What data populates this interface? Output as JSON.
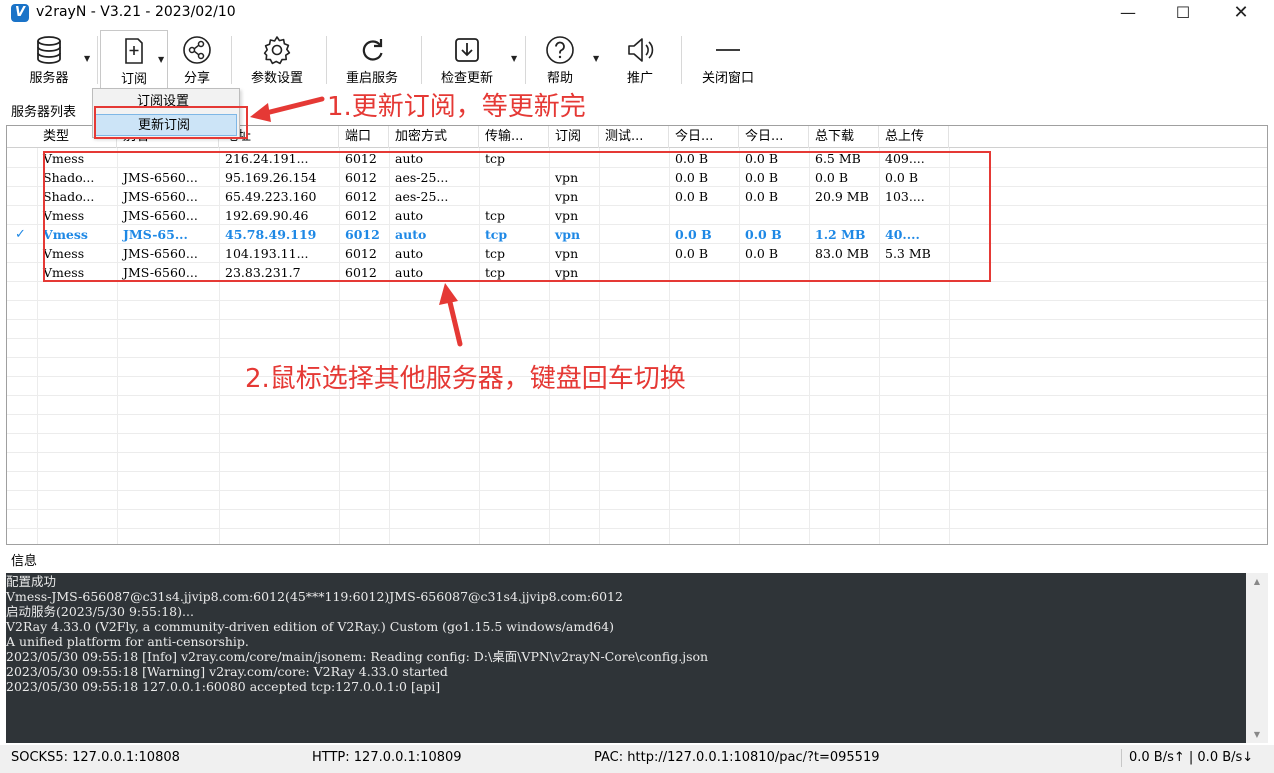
{
  "window": {
    "title": "v2rayN - V3.21 - 2023/02/10",
    "icon_letter": "V",
    "minimize": "—",
    "maximize": "☐",
    "close": "✕"
  },
  "toolbar": [
    {
      "key": "servers",
      "label": "服务器",
      "icon": "database-icon",
      "dropdown": true
    },
    {
      "key": "subscribe",
      "label": "订阅",
      "icon": "subscribe-icon",
      "dropdown": true
    },
    {
      "key": "share",
      "label": "分享",
      "icon": "share-icon",
      "dropdown": false
    },
    {
      "key": "settings",
      "label": "参数设置",
      "icon": "gear-icon",
      "dropdown": false
    },
    {
      "key": "restart",
      "label": "重启服务",
      "icon": "refresh-icon",
      "dropdown": false
    },
    {
      "key": "update",
      "label": "检查更新",
      "icon": "download-icon",
      "dropdown": true
    },
    {
      "key": "help",
      "label": "帮助",
      "icon": "help-icon",
      "dropdown": true
    },
    {
      "key": "promote",
      "label": "推广",
      "icon": "speaker-icon",
      "dropdown": false
    },
    {
      "key": "close_window",
      "label": "关闭窗口",
      "icon": "minus-icon",
      "dropdown": false
    }
  ],
  "subscribe_menu": {
    "items": [
      "订阅设置",
      "更新订阅"
    ],
    "highlighted": "更新订阅"
  },
  "server_list": {
    "label": "服务器列表",
    "columns": [
      "类型",
      "别名",
      "地址",
      "端口",
      "加密方式",
      "传输...",
      "订阅",
      "测试...",
      "今日...",
      "今日...",
      "总下载",
      "总上传"
    ],
    "rows": [
      {
        "active": false,
        "cells": [
          "Vmess",
          "",
          "216.24.191...",
          "6012",
          "auto",
          "tcp",
          "",
          "",
          "0.0 B",
          "0.0 B",
          "6.5 MB",
          "409...."
        ]
      },
      {
        "active": false,
        "cells": [
          "Shado...",
          "JMS-6560...",
          "95.169.26.154",
          "6012",
          "aes-25...",
          "",
          "vpn",
          "",
          "0.0 B",
          "0.0 B",
          "0.0 B",
          "0.0 B"
        ]
      },
      {
        "active": false,
        "cells": [
          "Shado...",
          "JMS-6560...",
          "65.49.223.160",
          "6012",
          "aes-25...",
          "",
          "vpn",
          "",
          "0.0 B",
          "0.0 B",
          "20.9 MB",
          "103...."
        ]
      },
      {
        "active": false,
        "cells": [
          "Vmess",
          "JMS-6560...",
          "192.69.90.46",
          "6012",
          "auto",
          "tcp",
          "vpn",
          "",
          "",
          "",
          "",
          ""
        ]
      },
      {
        "active": true,
        "cells": [
          "Vmess",
          "JMS-65...",
          "45.78.49.119",
          "6012",
          "auto",
          "tcp",
          "vpn",
          "",
          "0.0 B",
          "0.0 B",
          "1.2 MB",
          "40...."
        ]
      },
      {
        "active": false,
        "cells": [
          "Vmess",
          "JMS-6560...",
          "104.193.11...",
          "6012",
          "auto",
          "tcp",
          "vpn",
          "",
          "0.0 B",
          "0.0 B",
          "83.0 MB",
          "5.3 MB"
        ]
      },
      {
        "active": false,
        "cells": [
          "Vmess",
          "JMS-6560...",
          "23.83.231.7",
          "6012",
          "auto",
          "tcp",
          "vpn",
          "",
          "",
          "",
          "",
          ""
        ]
      }
    ],
    "active_mark": "✓"
  },
  "annotations": {
    "step1": "1.更新订阅，等更新完",
    "step2": "2.鼠标选择其他服务器，键盘回车切换",
    "color": "#e53935"
  },
  "info": {
    "label": "信息",
    "lines": [
      "配置成功",
      "Vmess-JMS-656087@c31s4.jjvip8.com:6012(45***119:6012)JMS-656087@c31s4.jjvip8.com:6012",
      "启动服务(2023/5/30 9:55:18)...",
      "V2Ray 4.33.0 (V2Fly, a community-driven edition of V2Ray.) Custom (go1.15.5 windows/amd64)",
      "A unified platform for anti-censorship.",
      "2023/05/30 09:55:18 [Info] v2ray.com/core/main/jsonem: Reading config: D:\\桌面\\VPN\\v2rayN-Core\\config.json",
      "2023/05/30 09:55:18 [Warning] v2ray.com/core: V2Ray 4.33.0 started",
      "2023/05/30 09:55:18 127.0.0.1:60080 accepted tcp:127.0.0.1:0 [api]"
    ]
  },
  "status": {
    "socks": "SOCKS5:  127.0.0.1:10808",
    "http": "HTTP:  127.0.0.1:10809",
    "pac": "PAC:  http://127.0.0.1:10810/pac/?t=095519",
    "speed": "0.0 B/s↑ | 0.0 B/s↓"
  },
  "colors": {
    "accent": "#1e88e5",
    "log_bg": "#2f3438",
    "annotation": "#e53935"
  }
}
